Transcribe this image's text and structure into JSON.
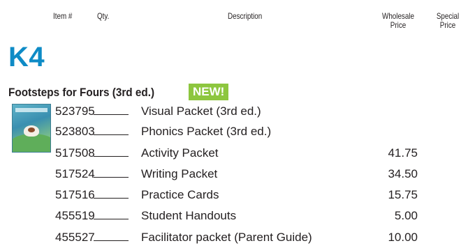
{
  "headers": {
    "item": "Item #",
    "qty": "Qty.",
    "description": "Description",
    "wholesale_line1": "Wholesale",
    "wholesale_line2": "Price",
    "special_line1": "Special",
    "special_line2": "Price"
  },
  "grade": "K4",
  "section": {
    "title": "Footsteps for Fours (3rd ed.)",
    "badge": "NEW!",
    "badge_color": "#8dc63f",
    "grade_color": "#0e8bc6"
  },
  "items": [
    {
      "item": "523795",
      "description": "Visual Packet (3rd ed.)",
      "price": ""
    },
    {
      "item": "523803",
      "description": "Phonics Packet (3rd ed.)",
      "price": ""
    },
    {
      "item": "517508",
      "description": "Activity Packet",
      "price": "41.75"
    },
    {
      "item": "517524",
      "description": "Writing Packet",
      "price": "34.50"
    },
    {
      "item": "517516",
      "description": "Practice Cards",
      "price": "15.75"
    },
    {
      "item": "455519",
      "description": "Student Handouts",
      "price": "5.00"
    },
    {
      "item": "455527",
      "description": "Facilitator packet (Parent Guide)",
      "price": "10.00"
    }
  ]
}
